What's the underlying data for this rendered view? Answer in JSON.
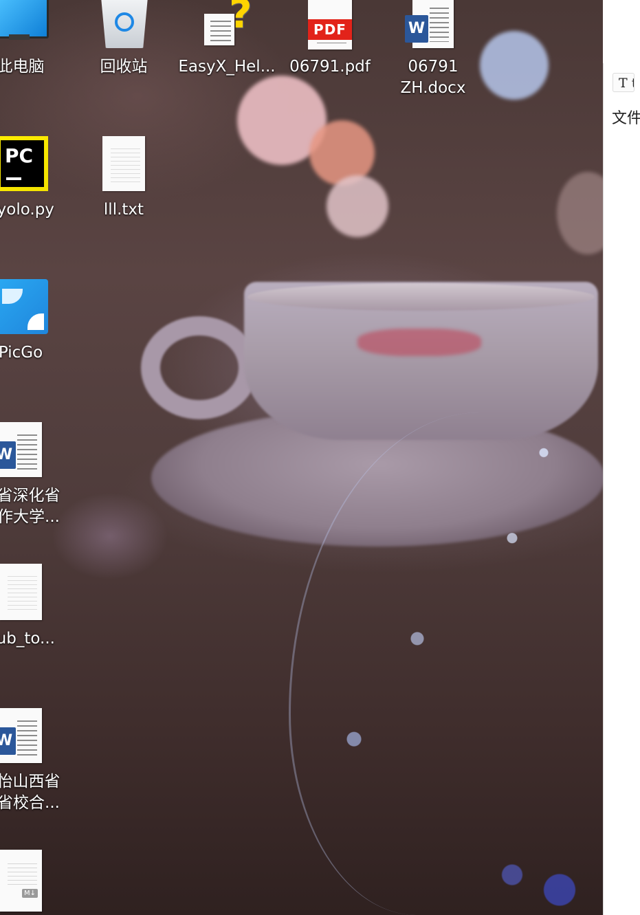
{
  "desktop": {
    "icons": [
      {
        "id": "this-pc",
        "label": "此电脑",
        "icon": "computer-icon"
      },
      {
        "id": "recycle-bin",
        "label": "回收站",
        "icon": "recycle-bin-icon"
      },
      {
        "id": "easyx-help",
        "label": "EasyX_Hel...",
        "icon": "help-document-icon"
      },
      {
        "id": "pdf-06791",
        "label": "06791.pdf",
        "icon": "pdf-file-icon",
        "badge": "PDF"
      },
      {
        "id": "docx-06791",
        "label": "06791\nZH.docx",
        "icon": "word-document-icon",
        "badge": "W"
      },
      {
        "id": "pyyolo",
        "label": "nyolo.py",
        "icon": "pycharm-icon",
        "badge": "PC"
      },
      {
        "id": "lll-txt",
        "label": "lll.txt",
        "icon": "text-file-icon"
      },
      {
        "id": "picgo",
        "label": "PicGo",
        "icon": "picgo-icon"
      },
      {
        "id": "word-doc-1",
        "label": "西省深化省\n合作大学...",
        "icon": "word-document-icon",
        "badge": "W"
      },
      {
        "id": "hub-to",
        "label": "hub_to...",
        "icon": "text-file-icon"
      },
      {
        "id": "word-doc-2",
        "label": "泽怡山西省\n化省校合...",
        "icon": "word-document-icon",
        "badge": "W"
      },
      {
        "id": "markdown-file",
        "label": "",
        "icon": "markdown-file-icon",
        "badge": "M↓"
      }
    ]
  },
  "app_window": {
    "toolbar_button": "T t",
    "menu_text": "文件"
  },
  "colors": {
    "word_blue": "#2b579a",
    "pdf_red": "#e2231a",
    "pycharm_yellow": "#ffee00",
    "picgo_blue": "#1f86dc"
  }
}
